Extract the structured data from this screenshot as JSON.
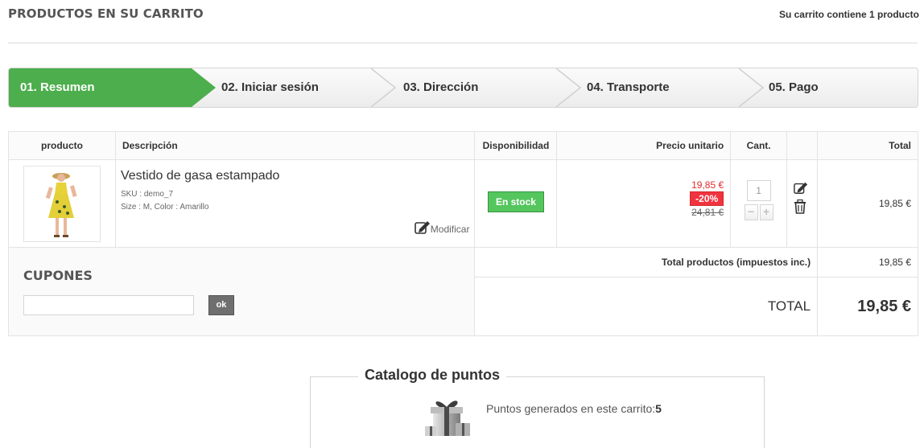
{
  "header": {
    "title": "PRODUCTOS EN SU CARRITO",
    "cart_summary": "Su carrito contiene 1 producto"
  },
  "steps": [
    {
      "label": "01. Resumen",
      "active": true
    },
    {
      "label": "02. Iniciar sesión",
      "active": false
    },
    {
      "label": "03. Dirección",
      "active": false
    },
    {
      "label": "04. Transporte",
      "active": false
    },
    {
      "label": "05. Pago",
      "active": false
    }
  ],
  "table": {
    "headers": {
      "product": "producto",
      "description": "Descripción",
      "availability": "Disponibilidad",
      "unit_price": "Precio unitario",
      "qty": "Cant.",
      "total": "Total"
    },
    "item": {
      "name": "Vestido de gasa estampado",
      "sku": "SKU : demo_7",
      "attributes": "Size : M, Color : Amarillo",
      "modify_label": "Modificar",
      "availability": "En stock",
      "price": "19,85 €",
      "reduction": "-20%",
      "old_price": "24,81 €",
      "quantity": "1",
      "qty_minus": "−",
      "qty_plus": "+",
      "total": "19,85 €",
      "icons": [
        "edit-icon",
        "trash-icon"
      ]
    },
    "subtotal_label": "Total productos (impuestos inc.)",
    "subtotal_value": "19,85 €",
    "grand_total_label": "TOTAL",
    "grand_total_value": "19,85 €"
  },
  "coupons": {
    "title": "CUPONES",
    "input_value": "",
    "button_label": "ok"
  },
  "points": {
    "legend": "Catalogo de puntos",
    "text": "Puntos generados en este carrito:",
    "value": "5"
  },
  "colors": {
    "active_step": "#4cae4c",
    "stock_badge": "#55c65e",
    "reduction_badge": "#f13340",
    "price_new": "#e4292d"
  }
}
